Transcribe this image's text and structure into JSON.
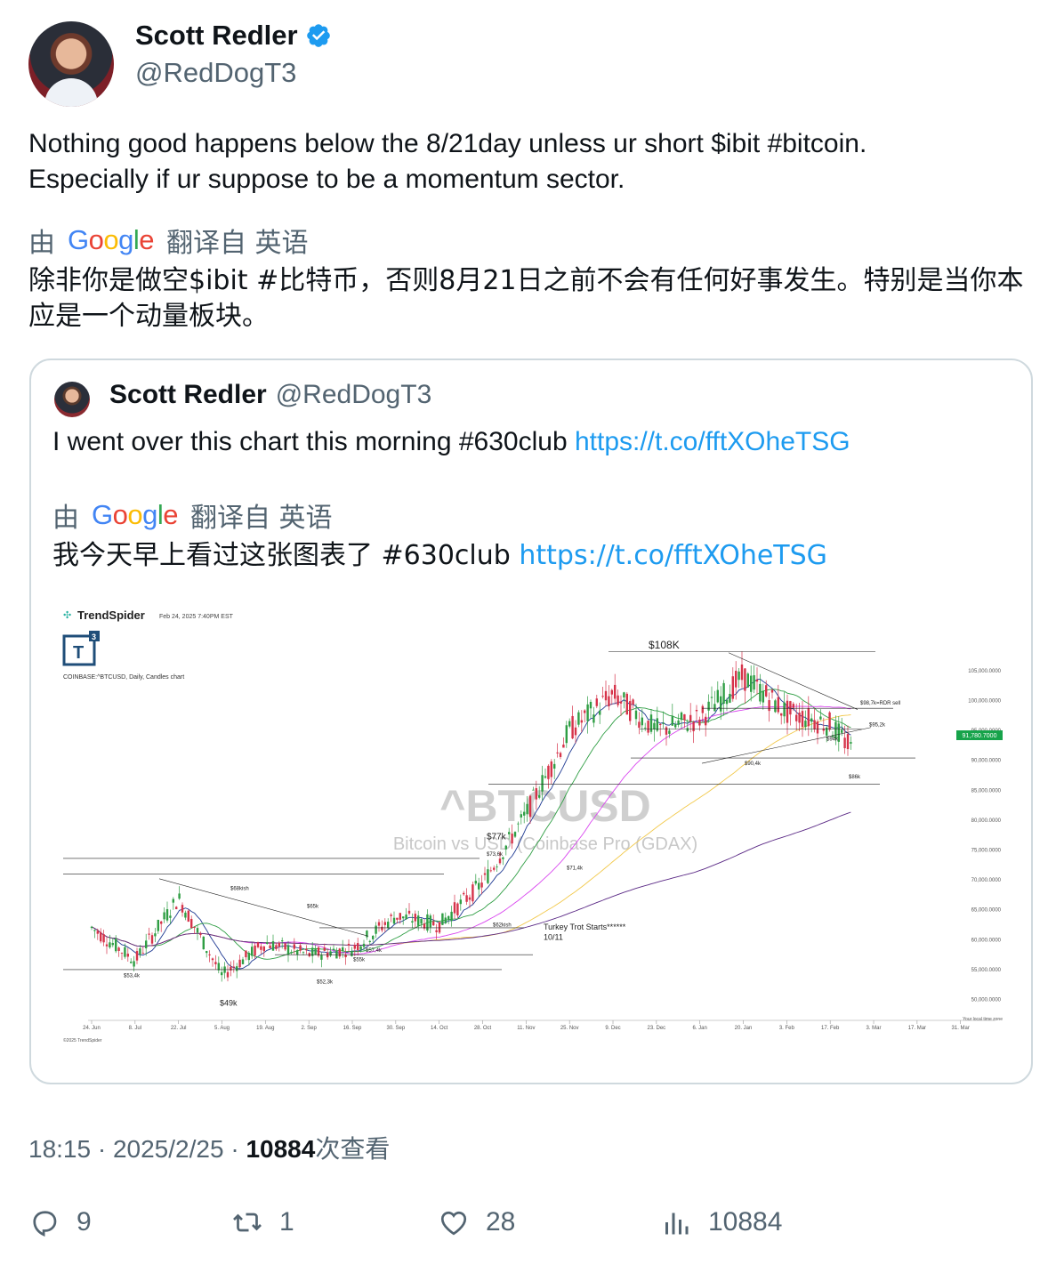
{
  "author": {
    "name": "Scott Redler",
    "handle": "@RedDogT3",
    "verified": true
  },
  "tweet": {
    "text_line1": "Nothing good happens below the 8/21day unless ur short $ibit #bitcoin.",
    "text_line2": "Especially if ur suppose to be a momentum sector.",
    "translate_prefix": "由",
    "translate_brand": "Google",
    "translate_suffix": "翻译自 英语",
    "translated_text": "除非你是做空$ibit #比特币，否则8月21日之前不会有任何好事发生。特别是当你本应是一个动量板块。"
  },
  "quote": {
    "name": "Scott Redler",
    "handle": "@RedDogT3",
    "text": "I went over this chart this morning #630club ",
    "link": "https://t.co/fftXOheTSG",
    "translate_prefix": "由",
    "translate_brand": "Google",
    "translate_suffix": "翻译自 英语",
    "translated_text": "我今天早上看过这张图表了 #630club ",
    "translated_link": "https://t.co/fftXOheTSG"
  },
  "chart_image": {
    "brand": "TrendSpider",
    "timestamp": "Feb 24, 2025 7:40PM EST",
    "badge": "T",
    "badge_sup": "3",
    "instrument": "COINBASE:^BTCUSD, Daily, Candles chart",
    "watermark_title": "^BTCUSD",
    "watermark_subtitle": "Bitcoin vs USD (Coinbase Pro (GDAX)",
    "copyright": "©2025 TrendSpider",
    "timezone_note": "Your local time zone",
    "current_price": "91,780.7000",
    "annotations": {
      "top": "$108K",
      "rdr": "$98,7k=RDR sell",
      "p952": "$95,2k",
      "p94": "$94k",
      "p904": "$90,4k",
      "p86": "$86k",
      "p77": "$77k",
      "p736": "$73,6k",
      "p714": "$71,4k",
      "p68": "$68kish",
      "p65": "$65k",
      "p62": "$62kish",
      "turkey1": "Turkey Trot Starts******",
      "turkey2": "10/11",
      "p574": "$57,4k",
      "p55": "$55k",
      "p534": "$53,4k",
      "p523": "$52,3k",
      "p49": "$49k"
    }
  },
  "chart_data": {
    "type": "candlestick",
    "title": "^BTCUSD",
    "subtitle": "Bitcoin vs USD (Coinbase Pro (GDAX)",
    "x_ticks": [
      "24. Jun",
      "8. Jul",
      "22. Jul",
      "5. Aug",
      "19. Aug",
      "2. Sep",
      "16. Sep",
      "30. Sep",
      "14. Oct",
      "28. Oct",
      "11. Nov",
      "25. Nov",
      "9. Dec",
      "23. Dec",
      "6. Jan",
      "20. Jan",
      "3. Feb",
      "17. Feb",
      "3. Mar",
      "17. Mar",
      "31. Mar"
    ],
    "y_ticks": [
      "105,000.0000",
      "100,000.0000",
      "95,000.0000",
      "90,000.0000",
      "85,000.0000",
      "80,000.0000",
      "75,000.0000",
      "70,000.0000",
      "65,000.0000",
      "60,000.0000",
      "55,000.0000",
      "50,000.0000"
    ],
    "y_range": [
      48000,
      109000
    ],
    "approx_close_path": [
      {
        "x": "24. Jun",
        "y": 62000
      },
      {
        "x": "8. Jul",
        "y": 56500
      },
      {
        "x": "22. Jul",
        "y": 67000
      },
      {
        "x": "5. Aug",
        "y": 54000
      },
      {
        "x": "19. Aug",
        "y": 59500
      },
      {
        "x": "2. Sep",
        "y": 57500
      },
      {
        "x": "16. Sep",
        "y": 58500
      },
      {
        "x": "30. Sep",
        "y": 64000
      },
      {
        "x": "14. Oct",
        "y": 62500
      },
      {
        "x": "28. Oct",
        "y": 69500
      },
      {
        "x": "11. Nov",
        "y": 81000
      },
      {
        "x": "25. Nov",
        "y": 95000
      },
      {
        "x": "9. Dec",
        "y": 101000
      },
      {
        "x": "23. Dec",
        "y": 95000
      },
      {
        "x": "6. Jan",
        "y": 97000
      },
      {
        "x": "20. Jan",
        "y": 104000
      },
      {
        "x": "3. Feb",
        "y": 98000
      },
      {
        "x": "17. Feb",
        "y": 96000
      },
      {
        "x": "24. Feb",
        "y": 91780
      }
    ]
  },
  "footer": {
    "time": "18:15",
    "sep": "·",
    "date": "2025/2/25",
    "views_count": "10884",
    "views_label": "次查看"
  },
  "actions": {
    "replies": "9",
    "retweets": "1",
    "likes": "28",
    "views": "10884"
  },
  "colors": {
    "link": "#1d9bf0",
    "secondary_text": "#536471",
    "border": "#cfd9de",
    "price_tag": "#16a34a"
  }
}
